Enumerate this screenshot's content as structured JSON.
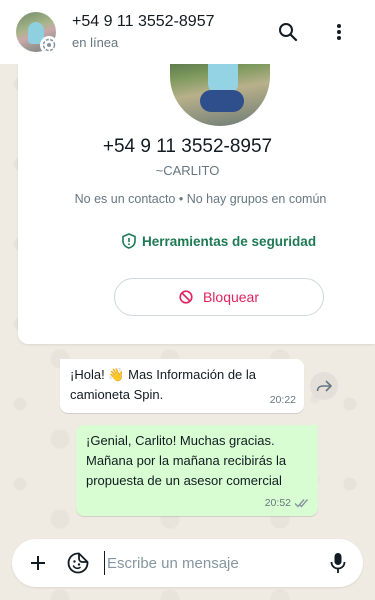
{
  "header": {
    "name": "+54 9 11 3552-8957",
    "status": "en línea"
  },
  "info": {
    "phone": "+54 9 11 3552-8957",
    "alias": "~CARLITO",
    "meta": "No es un contacto • No hay grupos en común",
    "safety_label": "Herramientas de seguridad",
    "block_label": "Bloquear"
  },
  "messages": [
    {
      "direction": "in",
      "text_before_emoji": "¡Hola!",
      "emoji": "👋",
      "text_after_emoji": "Mas Información de la camioneta Spin.",
      "time": "20:22"
    },
    {
      "direction": "out",
      "text": "¡Genial, Carlito! Muchas gracias. Mañana por la mañana recibirás la propuesta de un asesor comercial",
      "time": "20:52",
      "read": true
    }
  ],
  "composer": {
    "placeholder": "Escribe un mensaje"
  },
  "colors": {
    "accent_green": "#1e7a54",
    "block_red": "#e0245e",
    "outgoing_bubble": "#d9fdd3",
    "read_tick_blue": "#53bdeb"
  },
  "icons": [
    "search-icon",
    "menu-dots-icon",
    "shield-icon",
    "block-icon",
    "forward-icon",
    "plus-icon",
    "sticker-icon",
    "mic-icon",
    "double-check-icon",
    "status-ring-icon"
  ]
}
